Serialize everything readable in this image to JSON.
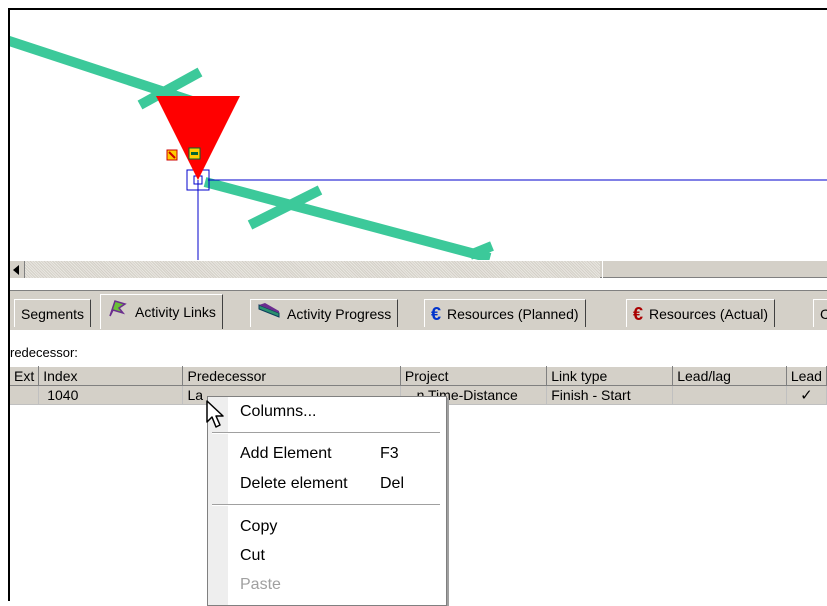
{
  "tabs": [
    {
      "label": "Segments",
      "icon": "segments-icon"
    },
    {
      "label": "Activity Links",
      "icon": "flag-link-icon",
      "active": true
    },
    {
      "label": "Activity Progress",
      "icon": "progress-icon"
    },
    {
      "label": "Resources (Planned)",
      "icon": "euro-icon"
    },
    {
      "label": "Resources (Actual)",
      "icon": "euro-icon"
    },
    {
      "label": "C",
      "icon": "clipped-tab"
    }
  ],
  "panel": {
    "label": "redecessor:"
  },
  "table": {
    "columns": [
      "Ext",
      "Index",
      "Predecessor",
      "Project",
      "Link type",
      "Lead/lag",
      "Lead"
    ],
    "rows": [
      {
        "ext": "",
        "index": "1040",
        "predecessor": "La",
        "project": "...n Time-Distance",
        "link_type": "Finish - Start",
        "lead_lag": "",
        "lead": "✓"
      }
    ]
  },
  "context_menu": {
    "columns": "Columns...",
    "add_element": "Add Element",
    "add_element_key": "F3",
    "delete_element": "Delete element",
    "delete_element_key": "Del",
    "copy": "Copy",
    "cut": "Cut",
    "paste": "Paste"
  },
  "colors": {
    "line_green": "#3cc99a",
    "marker_red": "#ff0000",
    "link_blue": "#0000cc",
    "window_gray": "#d4d0c8"
  }
}
